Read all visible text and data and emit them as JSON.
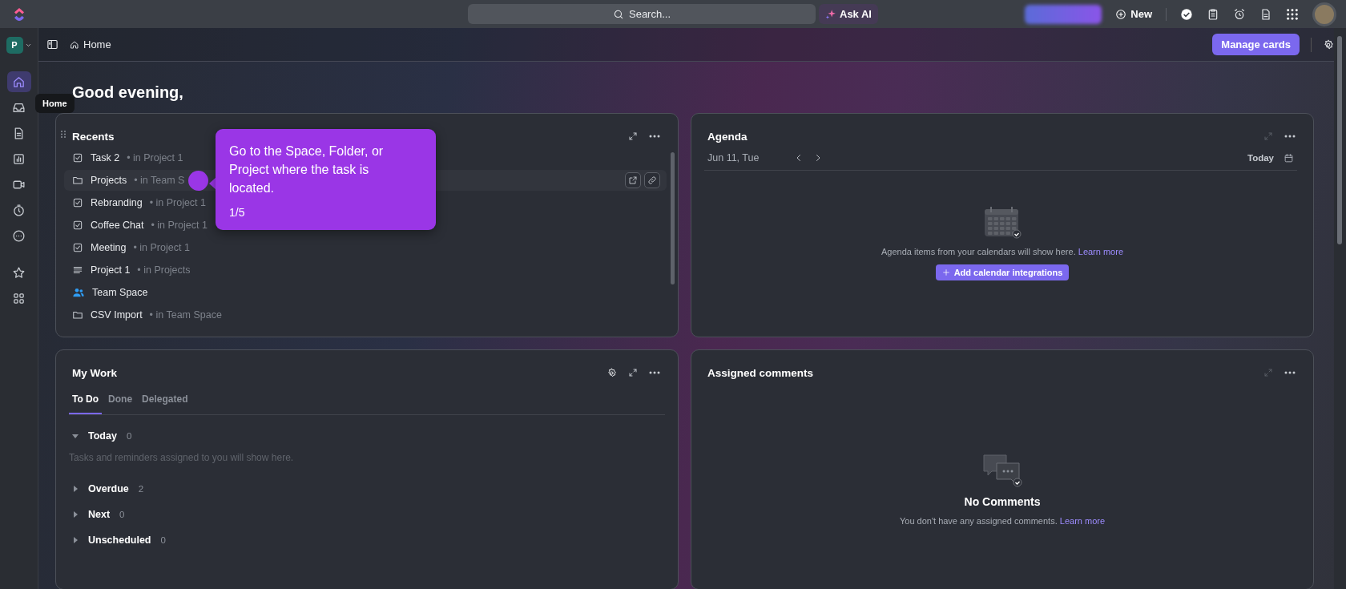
{
  "top_bar": {
    "search": {
      "placeholder": "Search..."
    },
    "ask_ai": "Ask AI",
    "new_button": "New"
  },
  "workspace": {
    "initial": "P"
  },
  "header": {
    "breadcrumb": "Home",
    "manage_cards": "Manage cards"
  },
  "rail": {
    "items": [
      {
        "kind": "home",
        "selected": true
      },
      {
        "kind": "inbox",
        "selected": false
      },
      {
        "kind": "doc",
        "selected": false
      },
      {
        "kind": "chart",
        "selected": false
      },
      {
        "kind": "video",
        "selected": false
      },
      {
        "kind": "timer",
        "selected": false
      },
      {
        "kind": "more",
        "selected": false
      },
      {
        "kind": "star",
        "selected": false
      },
      {
        "kind": "apps",
        "selected": false
      }
    ],
    "tooltip": "Home"
  },
  "greeting": "Good evening,",
  "recents": {
    "title": "Recents",
    "items": [
      {
        "kind": "task",
        "name": "Task 2",
        "location": "• in Project 1",
        "hovered": false
      },
      {
        "kind": "folder",
        "name": "Projects",
        "location": "• in Team S",
        "hovered": true
      },
      {
        "kind": "task",
        "name": "Rebranding",
        "location": "• in Project 1",
        "hovered": false
      },
      {
        "kind": "task",
        "name": "Coffee Chat",
        "location": "• in Project 1",
        "hovered": false
      },
      {
        "kind": "task",
        "name": "Meeting",
        "location": "• in Project 1",
        "hovered": false
      },
      {
        "kind": "list",
        "name": "Project 1",
        "location": "• in Projects",
        "hovered": false
      },
      {
        "kind": "space",
        "name": "Team Space",
        "hovered": false
      },
      {
        "kind": "folder",
        "name": "CSV Import",
        "location": "• in Team Space",
        "hovered": false
      }
    ],
    "tour": {
      "text": "Go to the Space, Folder, or Project where the task is located.",
      "step": "1/5"
    }
  },
  "agenda": {
    "title": "Agenda",
    "date": "Jun 11, Tue",
    "today": "Today",
    "empty_text": "Agenda items from your calendars will show here.",
    "learn_more": "Learn more",
    "add_button": "Add calendar integrations"
  },
  "my_work": {
    "title": "My Work",
    "tabs": [
      {
        "label": "To Do",
        "selected": true
      },
      {
        "label": "Done",
        "selected": false
      },
      {
        "label": "Delegated",
        "selected": false
      }
    ],
    "groups": [
      {
        "label": "Today",
        "count": "0",
        "expanded": true,
        "empty_text": "Tasks and reminders assigned to you will show here."
      },
      {
        "label": "Overdue",
        "count": "2",
        "expanded": false
      },
      {
        "label": "Next",
        "count": "0",
        "expanded": false
      },
      {
        "label": "Unscheduled",
        "count": "0",
        "expanded": false
      }
    ]
  },
  "comments": {
    "title": "Assigned comments",
    "heading": "No Comments",
    "text": "You don't have any assigned comments.",
    "learn_more": "Learn more"
  }
}
